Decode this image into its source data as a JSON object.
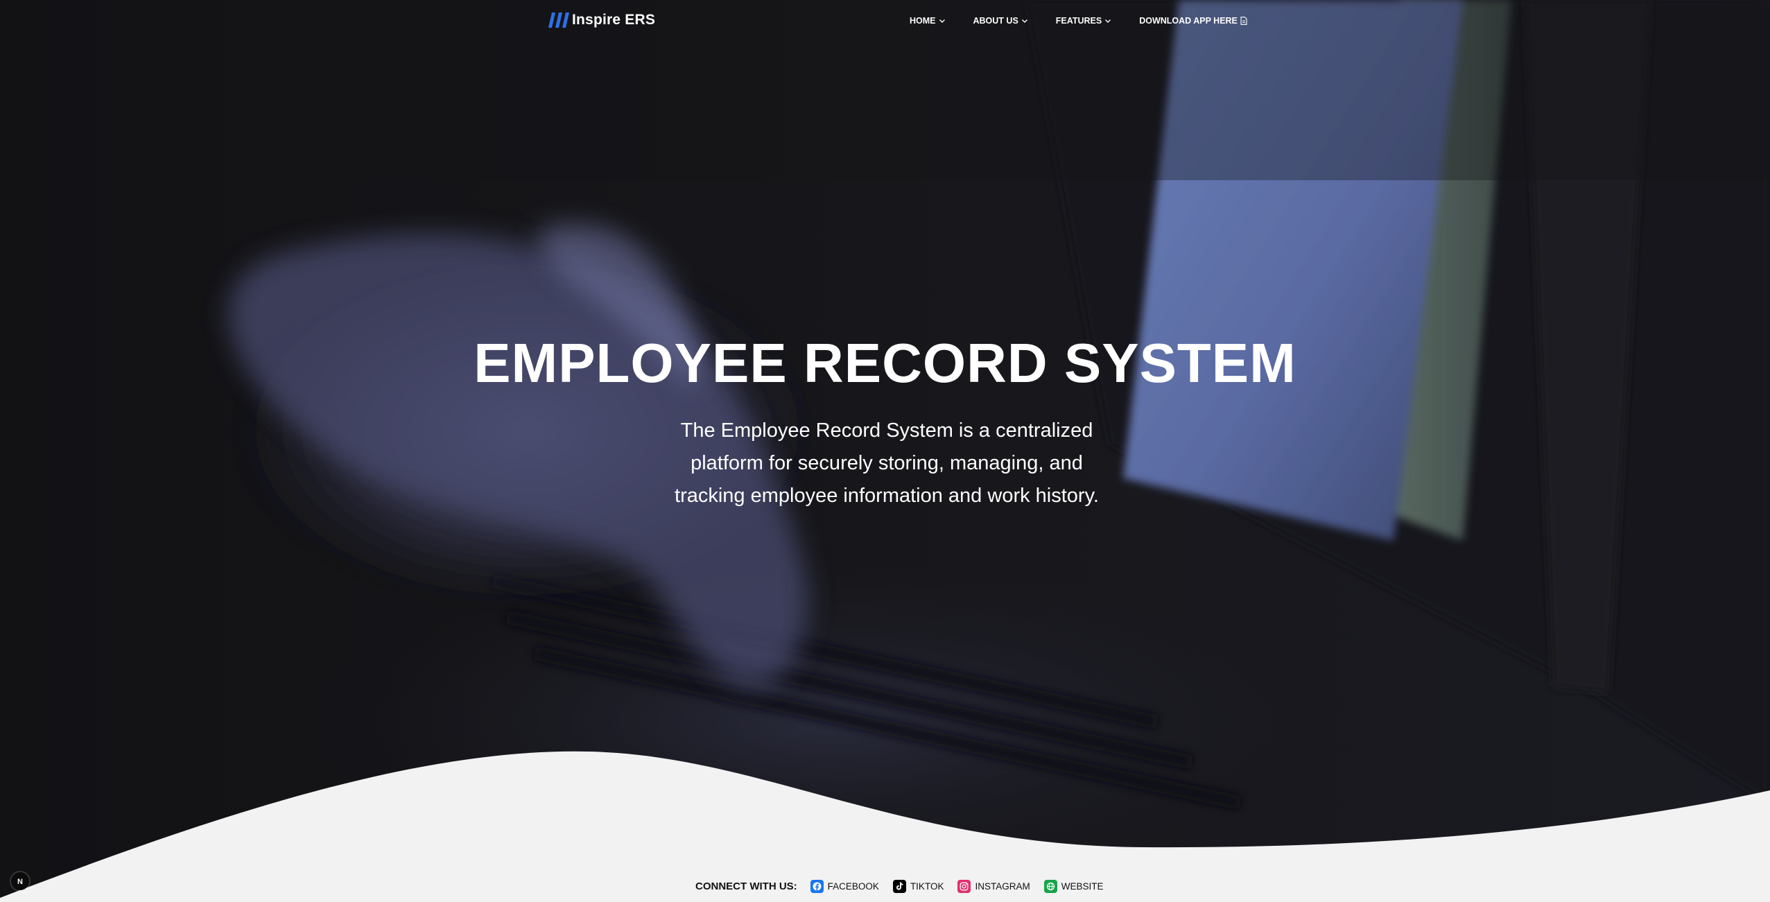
{
  "brand": {
    "name": "Inspire ERS",
    "logo_icon": "three-slanted-bars-logo",
    "logo_color": "#2f6fe8"
  },
  "nav": {
    "items": [
      {
        "label": "HOME",
        "icon": "chevron-down-icon"
      },
      {
        "label": "ABOUT US",
        "icon": "chevron-down-icon"
      },
      {
        "label": "FEATURES",
        "icon": "chevron-down-icon"
      },
      {
        "label": "DOWNLOAD APP HERE",
        "icon": "document-icon"
      }
    ]
  },
  "hero": {
    "title": "EMPLOYEE RECORD SYSTEM",
    "description": "The Employee Record System is a centralized platform for securely storing, managing, and tracking employee information and work history.",
    "background": "blurred-hands-typing-on-laptop-keyboard"
  },
  "footer": {
    "connect_label": "CONNECT WITH US:",
    "socials": [
      {
        "label": "FACEBOOK",
        "icon": "facebook-icon",
        "color": "#1877f2"
      },
      {
        "label": "TIKTOK",
        "icon": "tiktok-icon",
        "color": "#000000"
      },
      {
        "label": "INSTAGRAM",
        "icon": "instagram-icon",
        "color": "#e1306c"
      },
      {
        "label": "WEBSITE",
        "icon": "globe-icon",
        "color": "#1aa34a"
      }
    ],
    "wave_color": "#f2f2f2"
  },
  "dev_badge": {
    "letter": "N",
    "icon": "nextjs-dev-indicator-icon"
  }
}
